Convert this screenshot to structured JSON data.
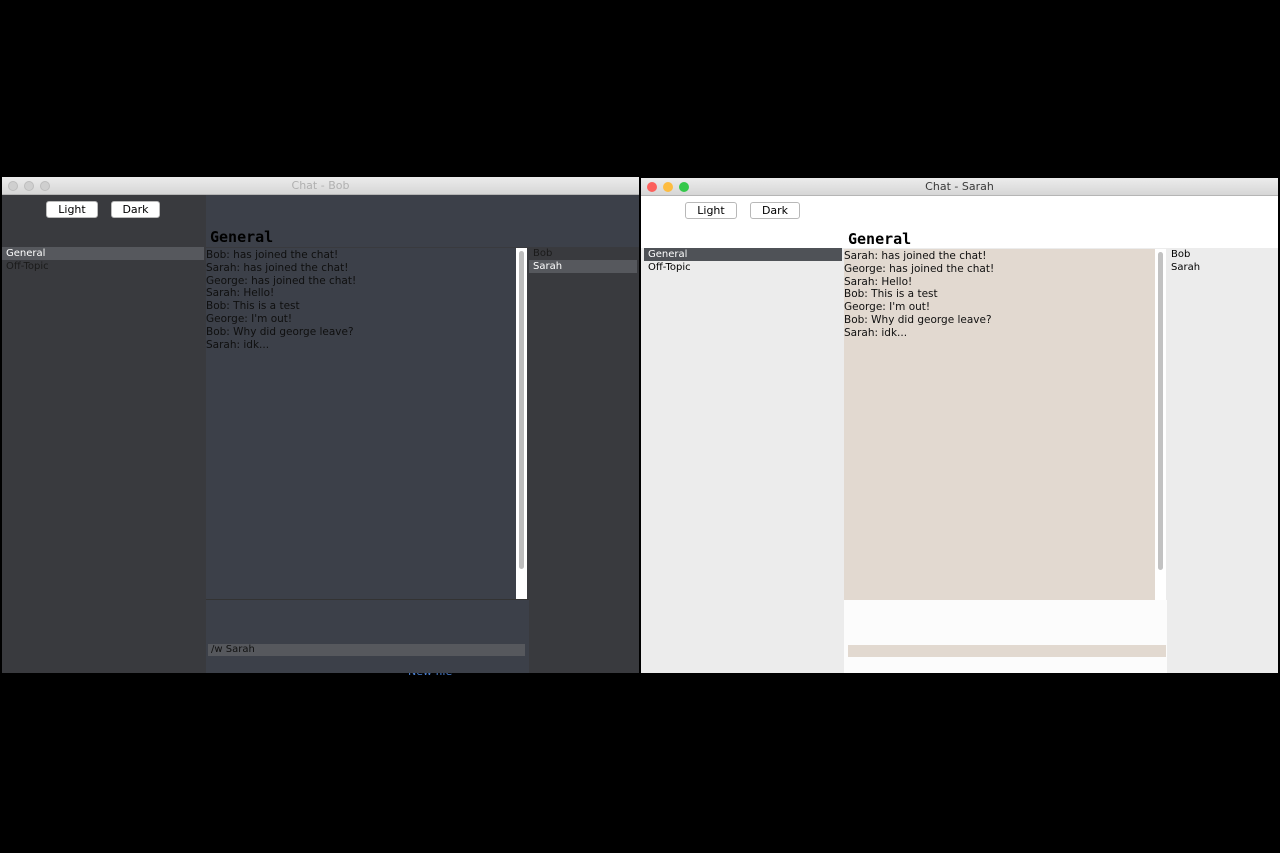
{
  "background_text": "New file",
  "windows": {
    "bob": {
      "title": "Chat - Bob",
      "theme": "dark",
      "light_label": "Light",
      "dark_label": "Dark",
      "channel_title": "General",
      "channels": [
        "General",
        "Off-Topic"
      ],
      "selected_channel": "General",
      "messages": [
        "Bob:  has joined the chat!",
        "Sarah:  has joined the chat!",
        "George:  has joined the chat!",
        "Sarah: Hello!",
        "Bob: This is a test",
        "George: I'm out!",
        "Bob: Why did george leave?",
        "Sarah: idk..."
      ],
      "users": [
        "Bob",
        "Sarah"
      ],
      "selected_user": "Sarah",
      "input_value": "/w Sarah"
    },
    "sarah": {
      "title": "Chat - Sarah",
      "theme": "light",
      "light_label": "Light",
      "dark_label": "Dark",
      "channel_title": "General",
      "channels": [
        "General",
        "Off-Topic"
      ],
      "selected_channel": "General",
      "messages": [
        "Sarah:  has joined the chat!",
        "George:  has joined the chat!",
        "Sarah: Hello!",
        "Bob: This is a test",
        "George: I'm out!",
        "Bob: Why did george leave?",
        "Sarah: idk..."
      ],
      "users": [
        "Bob",
        "Sarah"
      ],
      "input_value": ""
    }
  },
  "colors": {
    "dark_panel": "#393a3e",
    "dark_messages": "#3c4049",
    "dark_selection": "#56585d",
    "light_messages": "#e2d9d0",
    "light_selection": "#4f5257",
    "mac_close": "#fc605c",
    "mac_minimize": "#fdbc40",
    "mac_zoom": "#34c84a"
  }
}
